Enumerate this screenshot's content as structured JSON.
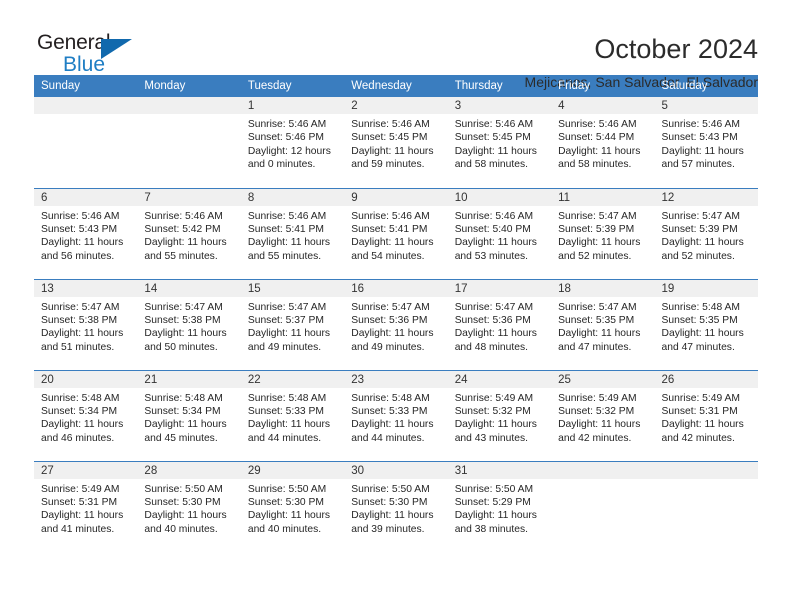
{
  "logo": {
    "text_dark": "General",
    "text_blue": "Blue",
    "triangle_color": "#1169ad"
  },
  "header": {
    "title": "October 2024",
    "subtitle": "Mejicanos, San Salvador, El Salvador"
  },
  "theme": {
    "header_bg": "#3a7dbf",
    "daynum_bg": "#f0f0f0",
    "row_border": "#3a7dbf",
    "text": "#262626"
  },
  "weekday_headers": [
    "Sunday",
    "Monday",
    "Tuesday",
    "Wednesday",
    "Thursday",
    "Friday",
    "Saturday"
  ],
  "weeks": [
    [
      {
        "day": "",
        "empty": true,
        "sunrise": "",
        "sunset": "",
        "daylight": ""
      },
      {
        "day": "",
        "empty": true,
        "sunrise": "",
        "sunset": "",
        "daylight": ""
      },
      {
        "day": "1",
        "sunrise": "Sunrise: 5:46 AM",
        "sunset": "Sunset: 5:46 PM",
        "daylight": "Daylight: 12 hours and 0 minutes."
      },
      {
        "day": "2",
        "sunrise": "Sunrise: 5:46 AM",
        "sunset": "Sunset: 5:45 PM",
        "daylight": "Daylight: 11 hours and 59 minutes."
      },
      {
        "day": "3",
        "sunrise": "Sunrise: 5:46 AM",
        "sunset": "Sunset: 5:45 PM",
        "daylight": "Daylight: 11 hours and 58 minutes."
      },
      {
        "day": "4",
        "sunrise": "Sunrise: 5:46 AM",
        "sunset": "Sunset: 5:44 PM",
        "daylight": "Daylight: 11 hours and 58 minutes."
      },
      {
        "day": "5",
        "sunrise": "Sunrise: 5:46 AM",
        "sunset": "Sunset: 5:43 PM",
        "daylight": "Daylight: 11 hours and 57 minutes."
      }
    ],
    [
      {
        "day": "6",
        "sunrise": "Sunrise: 5:46 AM",
        "sunset": "Sunset: 5:43 PM",
        "daylight": "Daylight: 11 hours and 56 minutes."
      },
      {
        "day": "7",
        "sunrise": "Sunrise: 5:46 AM",
        "sunset": "Sunset: 5:42 PM",
        "daylight": "Daylight: 11 hours and 55 minutes."
      },
      {
        "day": "8",
        "sunrise": "Sunrise: 5:46 AM",
        "sunset": "Sunset: 5:41 PM",
        "daylight": "Daylight: 11 hours and 55 minutes."
      },
      {
        "day": "9",
        "sunrise": "Sunrise: 5:46 AM",
        "sunset": "Sunset: 5:41 PM",
        "daylight": "Daylight: 11 hours and 54 minutes."
      },
      {
        "day": "10",
        "sunrise": "Sunrise: 5:46 AM",
        "sunset": "Sunset: 5:40 PM",
        "daylight": "Daylight: 11 hours and 53 minutes."
      },
      {
        "day": "11",
        "sunrise": "Sunrise: 5:47 AM",
        "sunset": "Sunset: 5:39 PM",
        "daylight": "Daylight: 11 hours and 52 minutes."
      },
      {
        "day": "12",
        "sunrise": "Sunrise: 5:47 AM",
        "sunset": "Sunset: 5:39 PM",
        "daylight": "Daylight: 11 hours and 52 minutes."
      }
    ],
    [
      {
        "day": "13",
        "sunrise": "Sunrise: 5:47 AM",
        "sunset": "Sunset: 5:38 PM",
        "daylight": "Daylight: 11 hours and 51 minutes."
      },
      {
        "day": "14",
        "sunrise": "Sunrise: 5:47 AM",
        "sunset": "Sunset: 5:38 PM",
        "daylight": "Daylight: 11 hours and 50 minutes."
      },
      {
        "day": "15",
        "sunrise": "Sunrise: 5:47 AM",
        "sunset": "Sunset: 5:37 PM",
        "daylight": "Daylight: 11 hours and 49 minutes."
      },
      {
        "day": "16",
        "sunrise": "Sunrise: 5:47 AM",
        "sunset": "Sunset: 5:36 PM",
        "daylight": "Daylight: 11 hours and 49 minutes."
      },
      {
        "day": "17",
        "sunrise": "Sunrise: 5:47 AM",
        "sunset": "Sunset: 5:36 PM",
        "daylight": "Daylight: 11 hours and 48 minutes."
      },
      {
        "day": "18",
        "sunrise": "Sunrise: 5:47 AM",
        "sunset": "Sunset: 5:35 PM",
        "daylight": "Daylight: 11 hours and 47 minutes."
      },
      {
        "day": "19",
        "sunrise": "Sunrise: 5:48 AM",
        "sunset": "Sunset: 5:35 PM",
        "daylight": "Daylight: 11 hours and 47 minutes."
      }
    ],
    [
      {
        "day": "20",
        "sunrise": "Sunrise: 5:48 AM",
        "sunset": "Sunset: 5:34 PM",
        "daylight": "Daylight: 11 hours and 46 minutes."
      },
      {
        "day": "21",
        "sunrise": "Sunrise: 5:48 AM",
        "sunset": "Sunset: 5:34 PM",
        "daylight": "Daylight: 11 hours and 45 minutes."
      },
      {
        "day": "22",
        "sunrise": "Sunrise: 5:48 AM",
        "sunset": "Sunset: 5:33 PM",
        "daylight": "Daylight: 11 hours and 44 minutes."
      },
      {
        "day": "23",
        "sunrise": "Sunrise: 5:48 AM",
        "sunset": "Sunset: 5:33 PM",
        "daylight": "Daylight: 11 hours and 44 minutes."
      },
      {
        "day": "24",
        "sunrise": "Sunrise: 5:49 AM",
        "sunset": "Sunset: 5:32 PM",
        "daylight": "Daylight: 11 hours and 43 minutes."
      },
      {
        "day": "25",
        "sunrise": "Sunrise: 5:49 AM",
        "sunset": "Sunset: 5:32 PM",
        "daylight": "Daylight: 11 hours and 42 minutes."
      },
      {
        "day": "26",
        "sunrise": "Sunrise: 5:49 AM",
        "sunset": "Sunset: 5:31 PM",
        "daylight": "Daylight: 11 hours and 42 minutes."
      }
    ],
    [
      {
        "day": "27",
        "sunrise": "Sunrise: 5:49 AM",
        "sunset": "Sunset: 5:31 PM",
        "daylight": "Daylight: 11 hours and 41 minutes."
      },
      {
        "day": "28",
        "sunrise": "Sunrise: 5:50 AM",
        "sunset": "Sunset: 5:30 PM",
        "daylight": "Daylight: 11 hours and 40 minutes."
      },
      {
        "day": "29",
        "sunrise": "Sunrise: 5:50 AM",
        "sunset": "Sunset: 5:30 PM",
        "daylight": "Daylight: 11 hours and 40 minutes."
      },
      {
        "day": "30",
        "sunrise": "Sunrise: 5:50 AM",
        "sunset": "Sunset: 5:30 PM",
        "daylight": "Daylight: 11 hours and 39 minutes."
      },
      {
        "day": "31",
        "sunrise": "Sunrise: 5:50 AM",
        "sunset": "Sunset: 5:29 PM",
        "daylight": "Daylight: 11 hours and 38 minutes."
      },
      {
        "day": "",
        "empty": true,
        "sunrise": "",
        "sunset": "",
        "daylight": ""
      },
      {
        "day": "",
        "empty": true,
        "sunrise": "",
        "sunset": "",
        "daylight": ""
      }
    ]
  ]
}
